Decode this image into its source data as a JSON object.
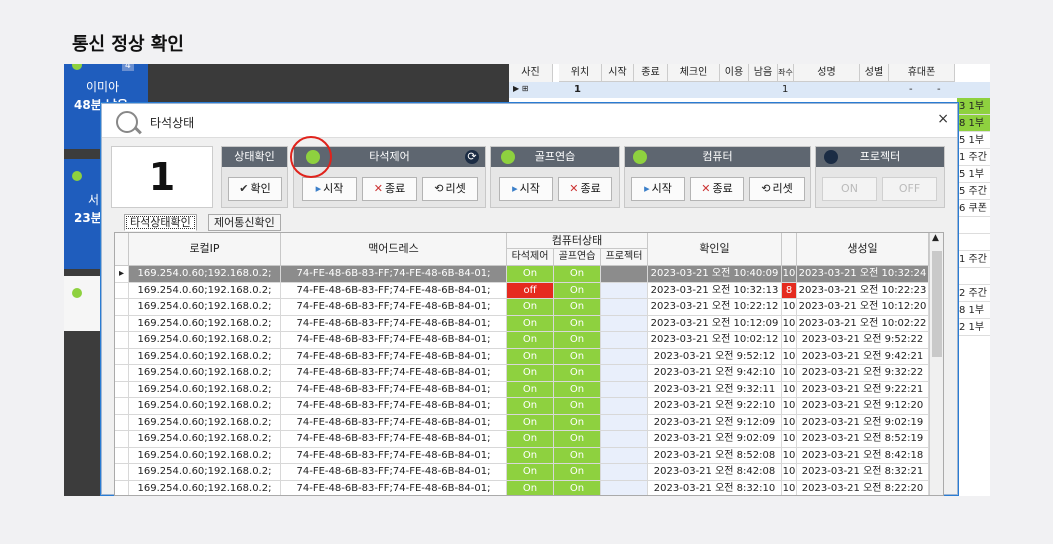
{
  "heading": "통신 정상 확인",
  "bg": {
    "card1": {
      "name": "이미아",
      "time": "48분 남음",
      "num": "4"
    },
    "card2": {
      "name": "서",
      "time": "23분"
    },
    "grid_headers": [
      "사진",
      "위치",
      "시작",
      "종료",
      "체크인",
      "이용",
      "남음",
      "좌수",
      "성명",
      "성별",
      "휴대폰"
    ],
    "grid_row": {
      "pos": "1",
      "count": "1",
      "a": "-",
      "b": "-"
    },
    "right_col": [
      "3 1부",
      "8 1부",
      "5 1부",
      "1 주간",
      "5 1부",
      "5 주간",
      "6 쿠폰",
      "",
      "",
      "1 주간",
      "",
      "2 주간",
      "8 1부",
      "2 1부"
    ]
  },
  "window": {
    "title": "타석상태",
    "close": "×",
    "number": "1",
    "status_check": {
      "header": "상태확인",
      "button": "확인"
    },
    "seat_control": {
      "header": "타석제어",
      "start": "시작",
      "end": "종료",
      "reset": "리셋"
    },
    "golf_practice": {
      "header": "골프연습",
      "start": "시작",
      "end": "종료"
    },
    "computer": {
      "header": "컴퓨터",
      "start": "시작",
      "end": "종료",
      "reset": "리셋"
    },
    "projector": {
      "header": "프로젝터",
      "on": "ON",
      "off": "OFF"
    },
    "tabs": [
      "타석상태확인",
      "제어통신확인"
    ],
    "columns": {
      "local_ip": "로컬IP",
      "mac": "맥어드레스",
      "pc_status": "컴퓨터상태",
      "seat_ctrl": "타석제어",
      "golf": "골프연습",
      "projector": "프로젝터",
      "confirm_date": "확인일",
      "created_date": "생성일"
    },
    "rows": [
      {
        "ip": "169.254.0.60;192.168.0.2;",
        "mac": "74-FE-48-6B-83-FF;74-FE-48-6B-84-01;",
        "seat": "On",
        "golf": "On",
        "confirm": "2023-03-21 오전 10:40:09",
        "n": "10",
        "created": "2023-03-21 오전 10:32:24"
      },
      {
        "ip": "169.254.0.60;192.168.0.2;",
        "mac": "74-FE-48-6B-83-FF;74-FE-48-6B-84-01;",
        "seat": "off",
        "golf": "On",
        "confirm": "2023-03-21 오전 10:32:13",
        "n": "8",
        "created": "2023-03-21 오전 10:22:23"
      },
      {
        "ip": "169.254.0.60;192.168.0.2;",
        "mac": "74-FE-48-6B-83-FF;74-FE-48-6B-84-01;",
        "seat": "On",
        "golf": "On",
        "confirm": "2023-03-21 오전 10:22:12",
        "n": "10",
        "created": "2023-03-21 오전 10:12:20"
      },
      {
        "ip": "169.254.0.60;192.168.0.2;",
        "mac": "74-FE-48-6B-83-FF;74-FE-48-6B-84-01;",
        "seat": "On",
        "golf": "On",
        "confirm": "2023-03-21 오전 10:12:09",
        "n": "10",
        "created": "2023-03-21 오전 10:02:22"
      },
      {
        "ip": "169.254.0.60;192.168.0.2;",
        "mac": "74-FE-48-6B-83-FF;74-FE-48-6B-84-01;",
        "seat": "On",
        "golf": "On",
        "confirm": "2023-03-21 오전 10:02:12",
        "n": "10",
        "created": "2023-03-21 오전 9:52:22"
      },
      {
        "ip": "169.254.0.60;192.168.0.2;",
        "mac": "74-FE-48-6B-83-FF;74-FE-48-6B-84-01;",
        "seat": "On",
        "golf": "On",
        "confirm": "2023-03-21 오전 9:52:12",
        "n": "10",
        "created": "2023-03-21 오전 9:42:21"
      },
      {
        "ip": "169.254.0.60;192.168.0.2;",
        "mac": "74-FE-48-6B-83-FF;74-FE-48-6B-84-01;",
        "seat": "On",
        "golf": "On",
        "confirm": "2023-03-21 오전 9:42:10",
        "n": "10",
        "created": "2023-03-21 오전 9:32:22"
      },
      {
        "ip": "169.254.0.60;192.168.0.2;",
        "mac": "74-FE-48-6B-83-FF;74-FE-48-6B-84-01;",
        "seat": "On",
        "golf": "On",
        "confirm": "2023-03-21 오전 9:32:11",
        "n": "10",
        "created": "2023-03-21 오전 9:22:21"
      },
      {
        "ip": "169.254.0.60;192.168.0.2;",
        "mac": "74-FE-48-6B-83-FF;74-FE-48-6B-84-01;",
        "seat": "On",
        "golf": "On",
        "confirm": "2023-03-21 오전 9:22:10",
        "n": "10",
        "created": "2023-03-21 오전 9:12:20"
      },
      {
        "ip": "169.254.0.60;192.168.0.2;",
        "mac": "74-FE-48-6B-83-FF;74-FE-48-6B-84-01;",
        "seat": "On",
        "golf": "On",
        "confirm": "2023-03-21 오전 9:12:09",
        "n": "10",
        "created": "2023-03-21 오전 9:02:19"
      },
      {
        "ip": "169.254.0.60;192.168.0.2;",
        "mac": "74-FE-48-6B-83-FF;74-FE-48-6B-84-01;",
        "seat": "On",
        "golf": "On",
        "confirm": "2023-03-21 오전 9:02:09",
        "n": "10",
        "created": "2023-03-21 오전 8:52:19"
      },
      {
        "ip": "169.254.0.60;192.168.0.2;",
        "mac": "74-FE-48-6B-83-FF;74-FE-48-6B-84-01;",
        "seat": "On",
        "golf": "On",
        "confirm": "2023-03-21 오전 8:52:08",
        "n": "10",
        "created": "2023-03-21 오전 8:42:18"
      },
      {
        "ip": "169.254.0.60;192.168.0.2;",
        "mac": "74-FE-48-6B-83-FF;74-FE-48-6B-84-01;",
        "seat": "On",
        "golf": "On",
        "confirm": "2023-03-21 오전 8:42:08",
        "n": "10",
        "created": "2023-03-21 오전 8:32:21"
      },
      {
        "ip": "169.254.0.60;192.168.0.2;",
        "mac": "74-FE-48-6B-83-FF;74-FE-48-6B-84-01;",
        "seat": "On",
        "golf": "On",
        "confirm": "2023-03-21 오전 8:32:10",
        "n": "10",
        "created": "2023-03-21 오전 8:22:20"
      }
    ]
  }
}
